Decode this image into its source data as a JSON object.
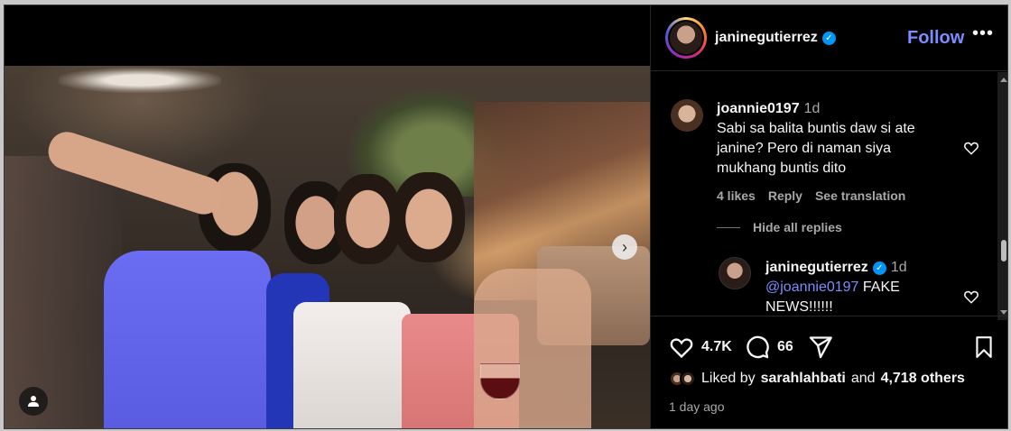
{
  "post": {
    "author": "janinegutierrez",
    "follow_label": "Follow",
    "more_label": "•••"
  },
  "comments": [
    {
      "username": "joannie0197",
      "time": "1d",
      "text": "Sabi sa balita buntis daw si ate janine? Pero di naman siya mukhang buntis dito",
      "likes": "4 likes",
      "reply_label": "Reply",
      "translation_label": "See translation"
    }
  ],
  "hide_replies_label": "Hide all replies",
  "reply": {
    "username": "janinegutierrez",
    "time": "1d",
    "mention": "@joannie0197",
    "text": " FAKE NEWS!!!!!!"
  },
  "actions": {
    "like_count": "4.7K",
    "comment_count": "66"
  },
  "liked_by": {
    "prefix": "Liked by",
    "user": "sarahlahbati",
    "middle": "and",
    "others": "4,718 others"
  },
  "time_ago": "1 day ago",
  "colors": {
    "accent": "#7c8cff",
    "verified": "#0095f6",
    "muted": "#a8a8a8",
    "background": "#000000"
  },
  "icons": [
    "heart-icon",
    "comment-icon",
    "share-icon",
    "bookmark-icon",
    "verified-icon",
    "chevron-right-icon",
    "user-icon"
  ]
}
